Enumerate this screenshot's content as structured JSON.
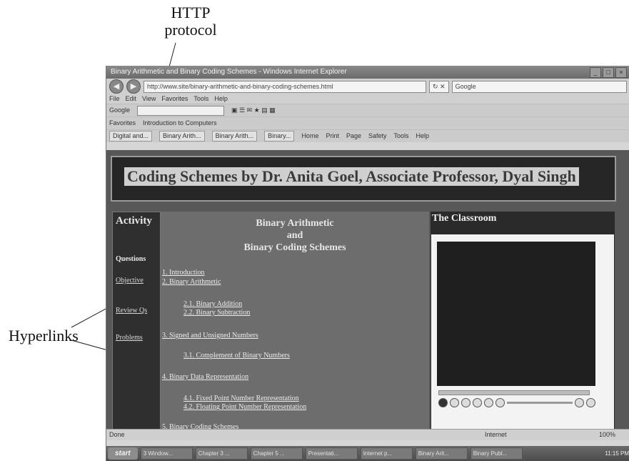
{
  "annotations": {
    "http_label_line1": "HTTP",
    "http_label_line2": "protocol",
    "hyperlinks_label": "Hyperlinks"
  },
  "window": {
    "title": "Binary Arithmetic and Binary Coding Schemes - Windows Internet Explorer",
    "url": "http://www.site/binary-arithmetic-and-binary-coding-schemes.html",
    "menu": [
      "File",
      "Edit",
      "View",
      "Favorites",
      "Tools",
      "Help"
    ],
    "google_label": "Google",
    "favorites_label": "Favorites",
    "favorite_item": "Introduction to Computers",
    "tabs": [
      "Digital and...",
      "Binary Arith...",
      "Binary Arith...",
      "Binary..."
    ],
    "tab_tools": [
      "Home",
      "Print",
      "Page",
      "Safety",
      "Tools",
      "Help"
    ]
  },
  "page": {
    "site_title": "Coding Schemes by Dr. Anita Goel, Associate Professor, Dyal Singh",
    "activity": {
      "heading": "Activity",
      "questions_label": "Questions",
      "links": [
        "Objective",
        "Review Qs",
        "Problems"
      ]
    },
    "main": {
      "heading_line1": "Binary Arithmetic",
      "heading_line2": "and",
      "heading_line3": "Binary Coding Schemes",
      "toc": [
        "1. Introduction",
        "2. Binary Arithmetic",
        "2.1. Binary Addition",
        "2.2. Binary Subtraction",
        "3. Signed and Unsigned Numbers",
        "3.1. Complement of Binary Numbers",
        "4. Binary Data Representation",
        "4.1. Fixed Point Number Representation",
        "4.2. Floating Point Number Representation",
        "5. Binary Coding Schemes"
      ]
    },
    "classroom": {
      "heading": "The Classroom"
    }
  },
  "status": {
    "left": "Done",
    "zone": "Internet",
    "zoom": "100%"
  },
  "taskbar": {
    "start": "start",
    "tasks": [
      "3 Window...",
      "Chapter 3 ...",
      "Chapter 5 ...",
      "Presentati...",
      "Internet p...",
      "Binary Arit...",
      "Binary Publ..."
    ],
    "clock": "11:15 PM"
  }
}
